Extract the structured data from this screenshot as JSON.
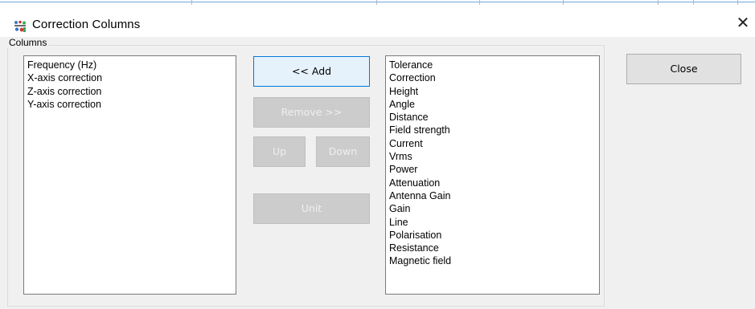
{
  "window": {
    "title": "Correction Columns",
    "close_glyph": "✕"
  },
  "icons": {
    "app": "correction-app-icon",
    "close": "close-icon"
  },
  "group": {
    "legend": "Columns"
  },
  "selected_columns": [
    "Frequency (Hz)",
    "X-axis correction",
    "Z-axis correction",
    "Y-axis correction"
  ],
  "available_columns": [
    "Tolerance",
    "Correction",
    "Height",
    "Angle",
    "Distance",
    "Field strength",
    "Current",
    "Vrms",
    "Power",
    "Attenuation",
    "Antenna Gain",
    "Gain",
    "Line",
    "Polarisation",
    "Resistance",
    "Magnetic field"
  ],
  "buttons": {
    "add": "<< Add",
    "remove": "Remove >>",
    "up": "Up",
    "down": "Down",
    "unit": "Unit",
    "close": "Close"
  },
  "colors": {
    "focus_border": "#0078d7",
    "focus_fill": "#e5f1fb",
    "disabled_fill": "#cccccc",
    "dialog_bg": "#f0f0f0"
  }
}
